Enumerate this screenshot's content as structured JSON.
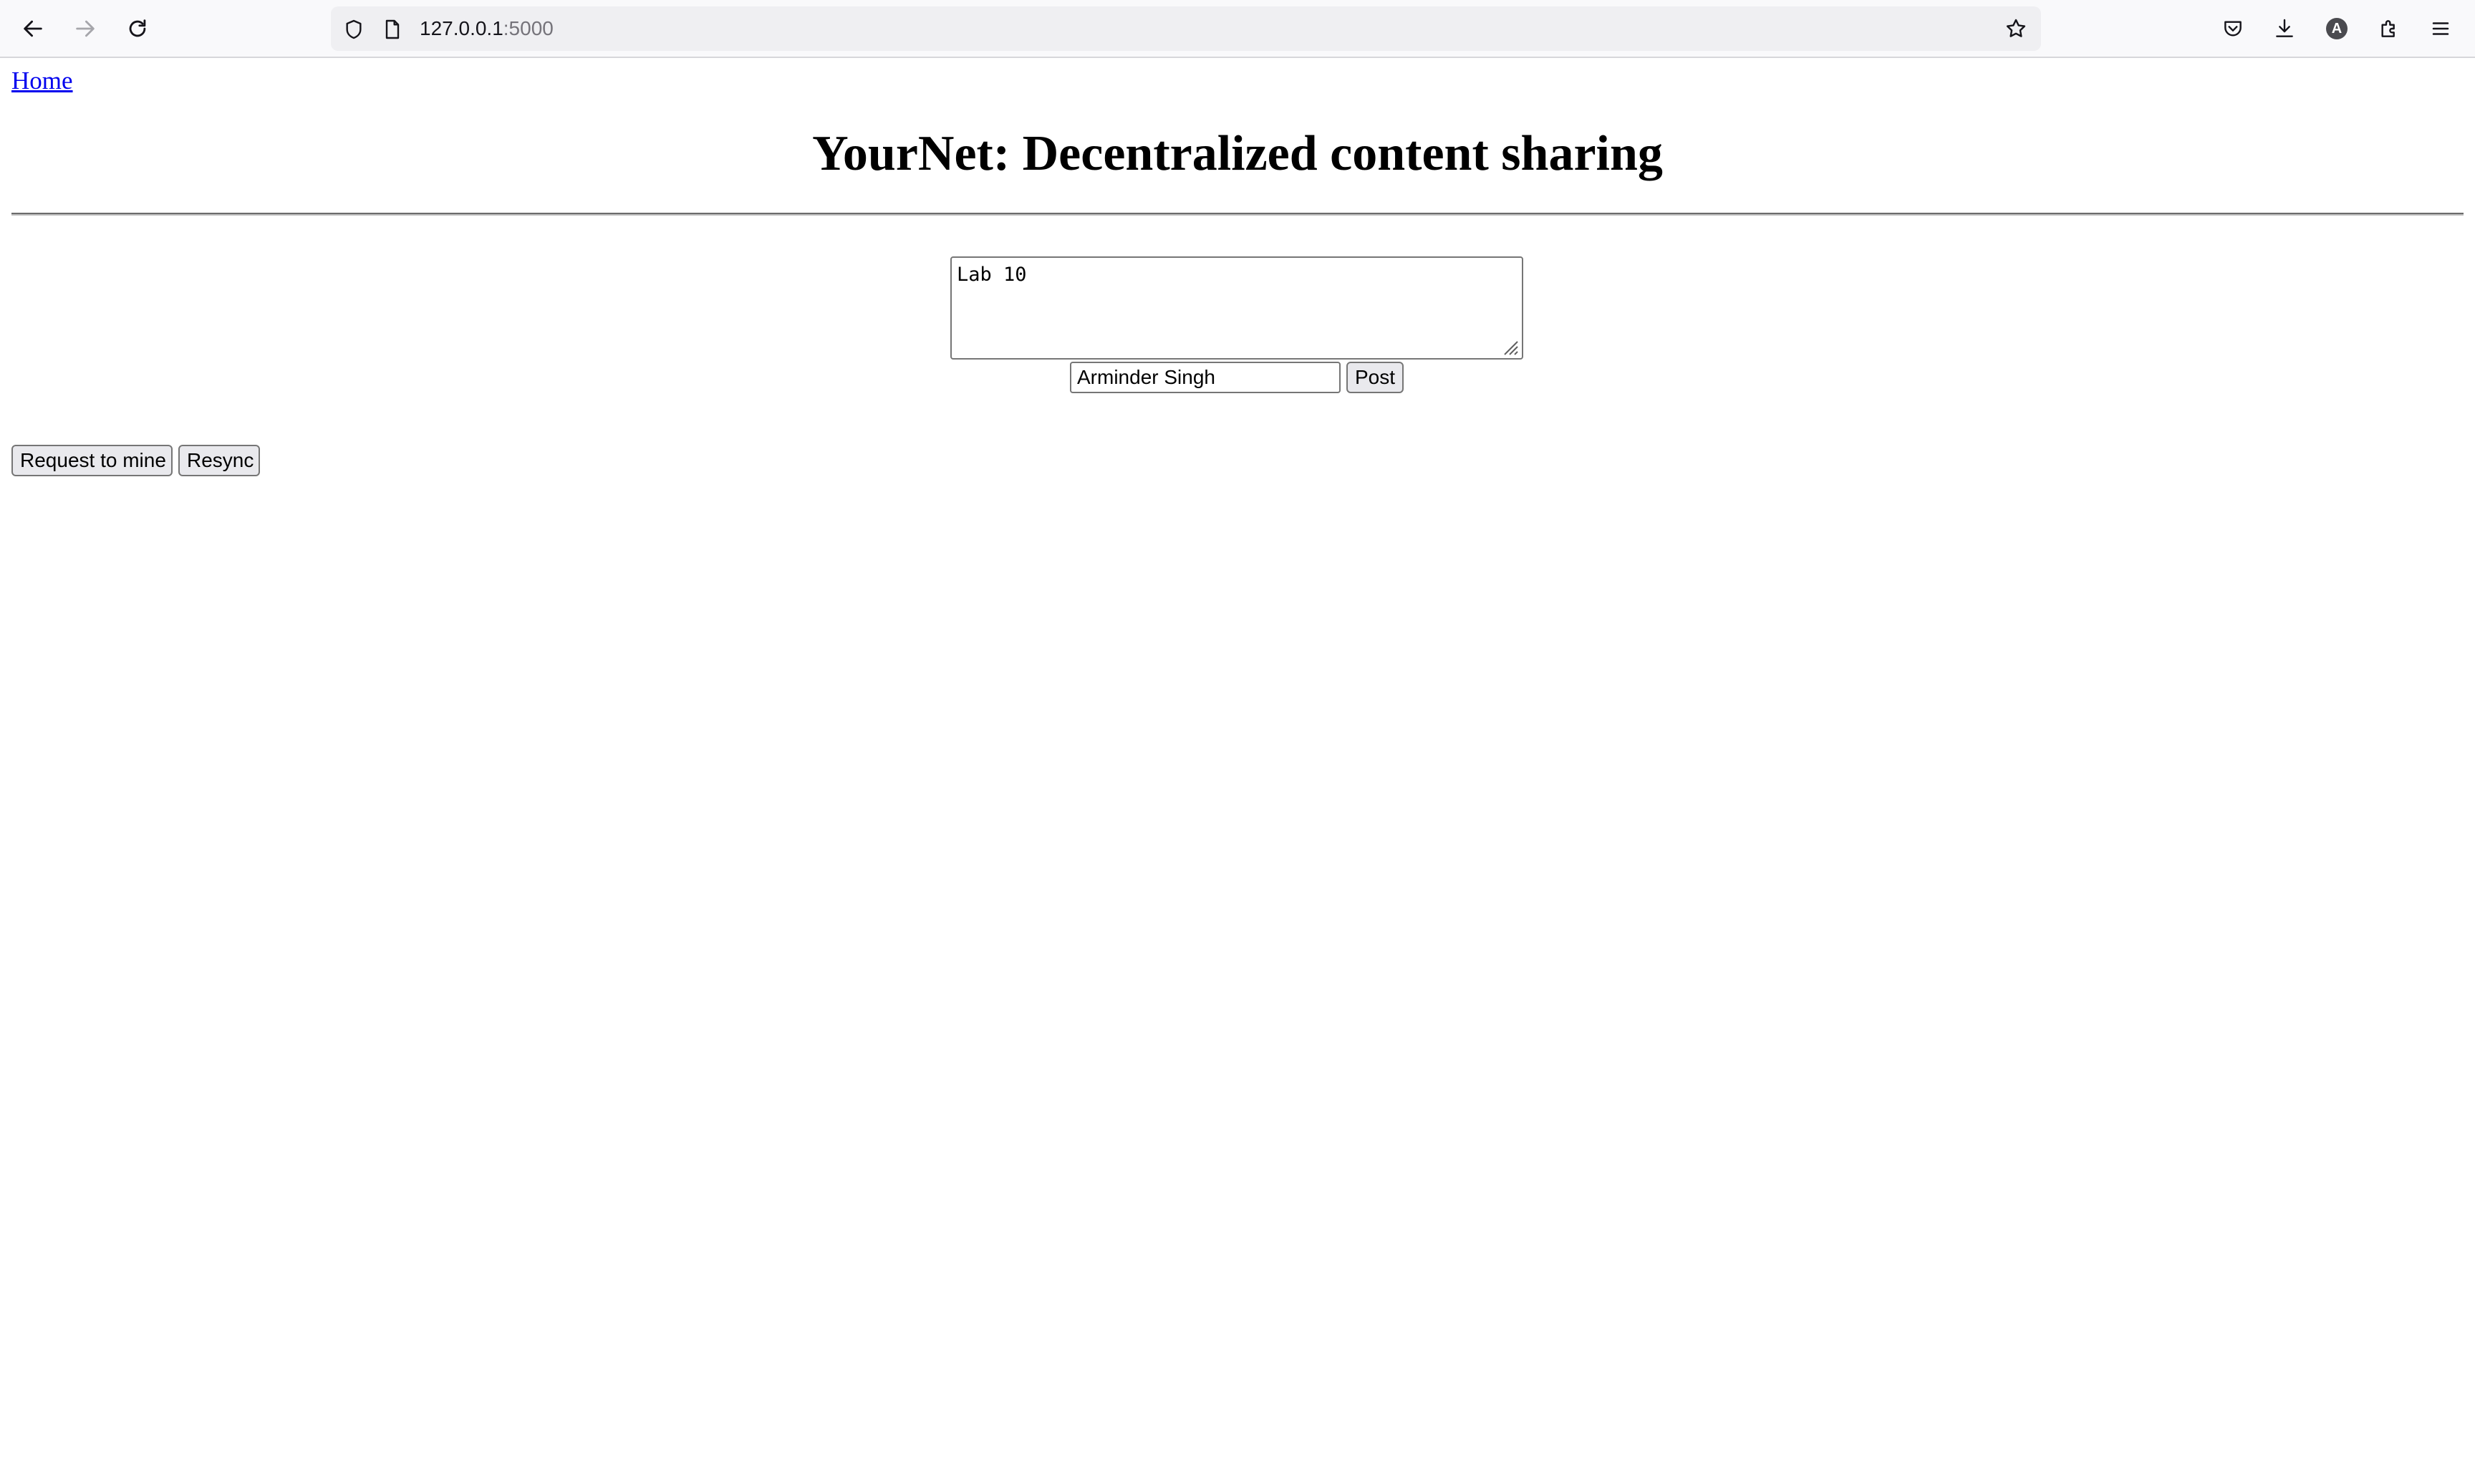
{
  "browser": {
    "url_host": "127.0.0.1",
    "url_port": ":5000",
    "profile_initial": "A",
    "icons": {
      "back": "arrow-left-icon",
      "forward": "arrow-right-icon",
      "reload": "reload-icon",
      "site_info": "shield-icon",
      "page": "page-icon",
      "bookmark": "star-icon",
      "pocket": "pocket-icon",
      "downloads": "download-icon",
      "extensions": "puzzle-icon",
      "menu": "hamburger-menu-icon"
    }
  },
  "page": {
    "home_link": "Home",
    "title": "YourNet: Decentralized content sharing",
    "post_text": "Lab 10",
    "author_name": "Arminder Singh",
    "post_button": "Post",
    "request_button": "Request to mine",
    "resync_button": "Resync"
  },
  "colors": {
    "link": "#0000ee",
    "button_bg": "#e9e9ed",
    "button_border": "#767676",
    "chrome_bg": "#f9f9fb",
    "urlbar_bg": "#efeff2"
  }
}
